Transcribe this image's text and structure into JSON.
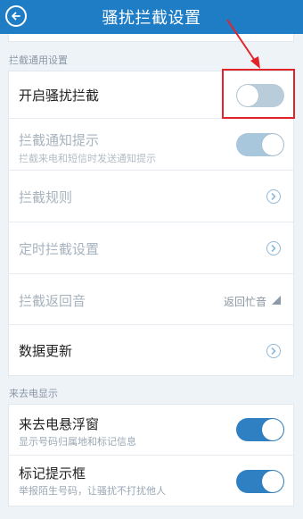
{
  "header": {
    "title": "骚扰拦截设置"
  },
  "sections": {
    "general": {
      "label": "拦截通用设置"
    },
    "incoming": {
      "label": "来去电显示"
    }
  },
  "general_rows": {
    "enable": {
      "title": "开启骚扰拦截",
      "state": "off"
    },
    "notify": {
      "title": "拦截通知提示",
      "subtitle": "拦截来电和短信时发送通知提示",
      "state": "on"
    },
    "rules": {
      "title": "拦截规则"
    },
    "schedule": {
      "title": "定时拦截设置"
    },
    "tone": {
      "title": "拦截返回音",
      "value": "返回忙音"
    },
    "update": {
      "title": "数据更新"
    }
  },
  "incoming_rows": {
    "float": {
      "title": "来去电悬浮窗",
      "subtitle": "显示号码归属地和标记信息",
      "state": "on"
    },
    "tag": {
      "title": "标记提示框",
      "subtitle": "举报陌生号码，让骚扰不打扰他人",
      "state": "on"
    }
  },
  "colors": {
    "header": "#1f7dc6",
    "toggle_on": "#2f7fc3",
    "toggle_off": "#b8ccd9",
    "annotation": "#e3232a"
  }
}
